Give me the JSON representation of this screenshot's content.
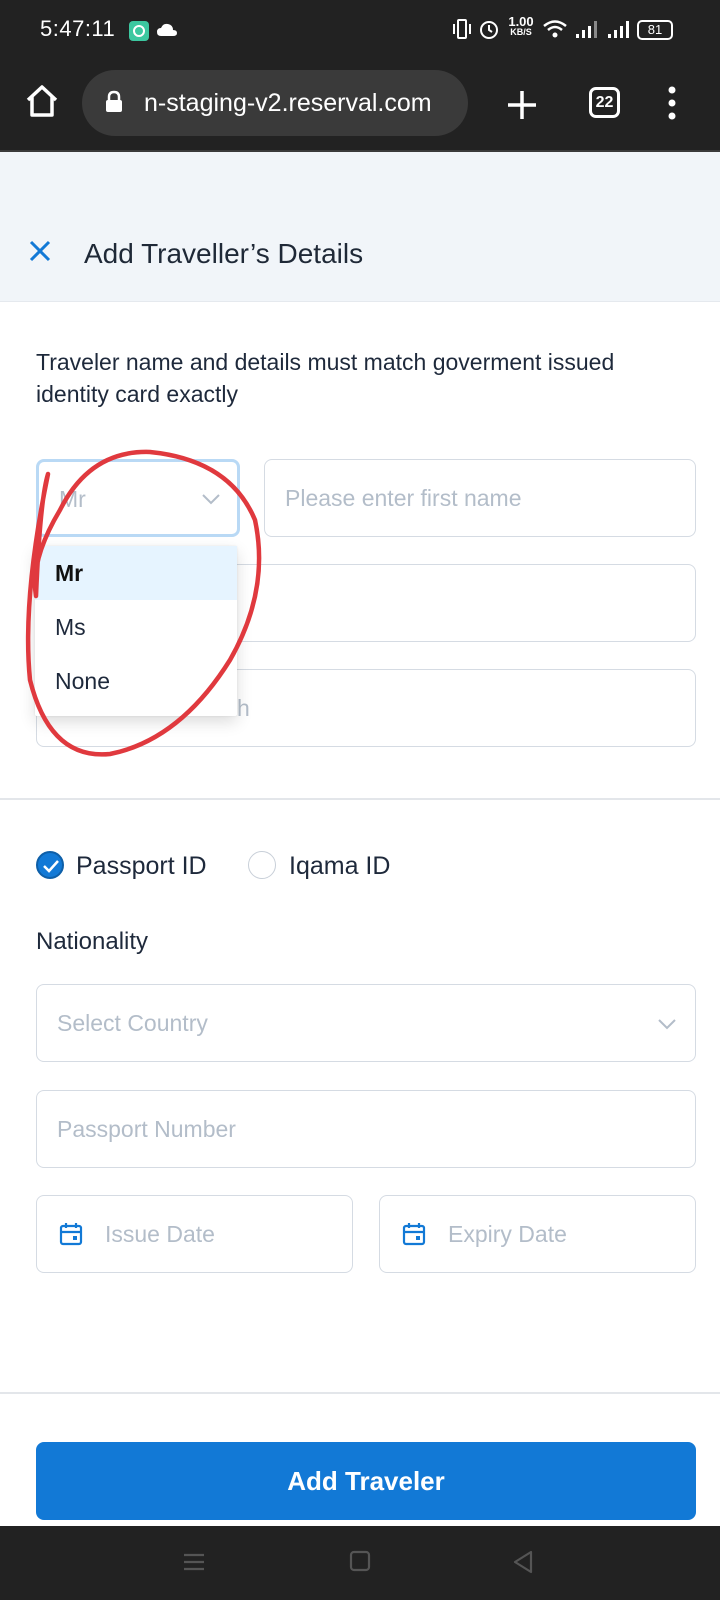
{
  "status_bar": {
    "time": "5:47:11",
    "net_speed_value": "1.00",
    "net_speed_unit": "KB/S",
    "battery": "81"
  },
  "browser": {
    "url": "n-staging-v2.reserval.com",
    "tab_count": "22"
  },
  "header": {
    "title": "Add Traveller’s Details"
  },
  "form": {
    "notice": "Traveler name and details must match goverment issued identity card exactly",
    "title_select": {
      "value": "Mr",
      "options": [
        "Mr",
        "Ms",
        "None"
      ],
      "selected_index": 0
    },
    "first_name_placeholder": "Please enter first name",
    "last_name_placeholder": "",
    "dob_placeholder_visible": "h",
    "id_types": [
      {
        "label": "Passport ID",
        "checked": true
      },
      {
        "label": "Iqama ID",
        "checked": false
      }
    ],
    "nationality_label": "Nationality",
    "country_placeholder": "Select Country",
    "passport_number_placeholder": "Passport Number",
    "issue_date_placeholder": "Issue Date",
    "expiry_date_placeholder": "Expiry Date",
    "submit_label": "Add Traveler"
  },
  "colors": {
    "accent": "#1279d6",
    "annotation": "#e0393e",
    "header_bg": "#f1f5f9",
    "system_bar": "#222222"
  },
  "icons": {
    "close": "close-icon",
    "chevron": "chevron-down-icon",
    "calendar": "calendar-icon",
    "home": "home-icon",
    "lock": "lock-icon",
    "plus": "plus-icon",
    "menu": "more-vert-icon"
  }
}
